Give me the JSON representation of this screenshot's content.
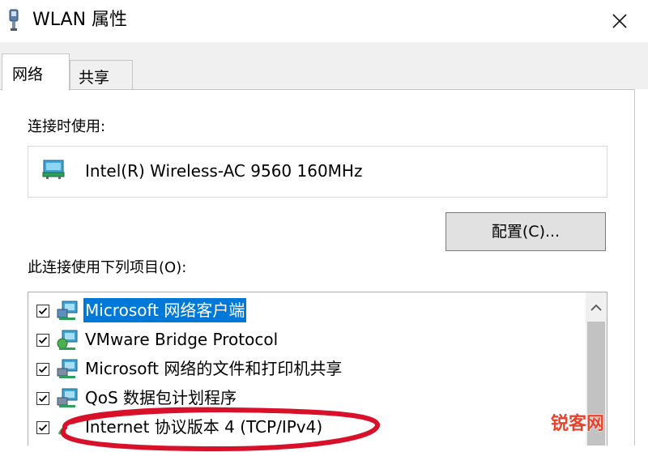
{
  "window": {
    "title": "WLAN 属性",
    "icon": "wlan-adapter-icon",
    "close": "close-icon"
  },
  "tabs": [
    {
      "label": "网络",
      "active": true
    },
    {
      "label": "共享",
      "active": false
    }
  ],
  "connect_section": {
    "label": "连接时使用:",
    "adapter_icon": "network-adapter-icon",
    "adapter_name": "Intel(R) Wireless-AC 9560 160MHz",
    "configure_button": "配置(C)..."
  },
  "items_section": {
    "label": "此连接使用下列项目(O):",
    "items": [
      {
        "label": "Microsoft 网络客户端",
        "checked": true,
        "selected": true,
        "icon": "network-client-icon"
      },
      {
        "label": "VMware Bridge Protocol",
        "checked": true,
        "selected": false,
        "icon": "network-protocol-icon"
      },
      {
        "label": "Microsoft 网络的文件和打印机共享",
        "checked": true,
        "selected": false,
        "icon": "network-service-icon"
      },
      {
        "label": "QoS 数据包计划程序",
        "checked": true,
        "selected": false,
        "icon": "network-service-icon"
      },
      {
        "label": "Internet 协议版本 4 (TCP/IPv4)",
        "checked": true,
        "selected": false,
        "icon": "network-protocol-icon"
      }
    ]
  },
  "annotation": {
    "highlight_color": "#d8102a"
  },
  "watermark": {
    "text": "锐客网",
    "color": "#e8412c"
  },
  "colors": {
    "selection": "#0078d7",
    "button_face": "#e1e1e1",
    "tab_strip": "#f0f0f0"
  }
}
